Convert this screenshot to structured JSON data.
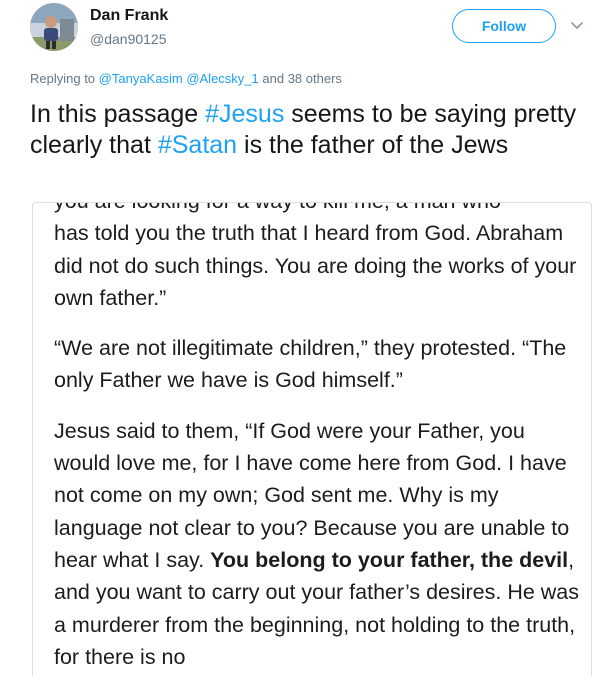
{
  "tweet": {
    "author_name": "Dan Frank",
    "author_handle": "@dan90125",
    "follow_label": "Follow",
    "avatar_icon": "user-avatar",
    "menu_icon": "chevron-down-icon",
    "reply": {
      "prefix": "Replying to",
      "mention_1": "@TanyaKasim",
      "mention_2": "@Alecsky_1",
      "suffix": "and 38 others"
    },
    "text": {
      "part_1": "In this passage ",
      "hashtag_1": "#Jesus",
      "part_2": " seems to be saying pretty clearly that ",
      "hashtag_2": "#Satan",
      "part_3": " is the father of the Jews"
    }
  },
  "passage": {
    "cut_line": "you are looking for a way to kill me, a man who",
    "p1": "has told you the truth that I heard from God. Abraham did not do such things. You are doing the works of your own father.”",
    "p2": "“We are not illegitimate children,” they protested. “The only Father we have is God himself.”",
    "p3_before": "Jesus said to them, “If God were your Father, you would love me, for I have come here from God. I have not come on my own; God sent me. Why is my language not clear to you? Because you are unable to hear what I say. ",
    "p3_bold": "You belong to your father, the devil",
    "p3_after": ", and you want to carry out your father’s desires. He was a murderer from the beginning, not holding to the truth, for there is no"
  },
  "colors": {
    "accent": "#1da1f2",
    "secondary_text": "#657786",
    "primary_text": "#14171a",
    "border": "#d9dee3"
  }
}
